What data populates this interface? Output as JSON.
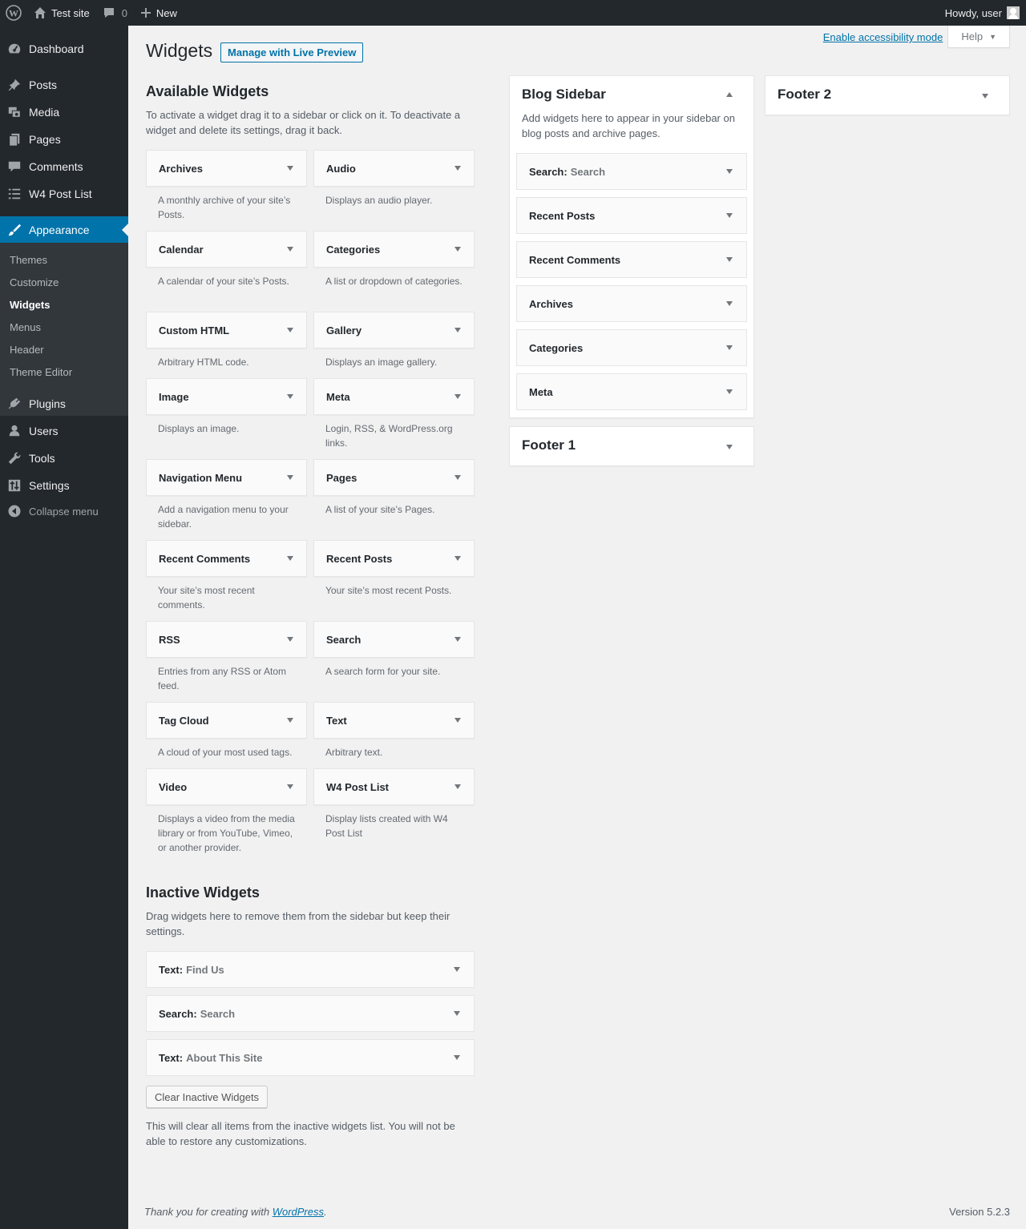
{
  "adminbar": {
    "site_name": "Test site",
    "comments_count": "0",
    "new_label": "New",
    "howdy": "Howdy, user"
  },
  "menu": {
    "items": [
      "Dashboard",
      "Posts",
      "Media",
      "Pages",
      "Comments",
      "W4 Post List",
      "Appearance",
      "Plugins",
      "Users",
      "Tools",
      "Settings"
    ],
    "submenu": [
      "Themes",
      "Customize",
      "Widgets",
      "Menus",
      "Header",
      "Theme Editor"
    ],
    "collapse": "Collapse menu"
  },
  "screen_meta": {
    "accessibility": "Enable accessibility mode",
    "help": "Help"
  },
  "header": {
    "title": "Widgets",
    "live_preview": "Manage with Live Preview"
  },
  "available": {
    "heading": "Available Widgets",
    "description": "To activate a widget drag it to a sidebar or click on it. To deactivate a widget and delete its settings, drag it back.",
    "widgets": [
      {
        "name": "Archives",
        "desc": "A monthly archive of your site’s Posts."
      },
      {
        "name": "Audio",
        "desc": "Displays an audio player."
      },
      {
        "name": "Calendar",
        "desc": "A calendar of your site’s Posts."
      },
      {
        "name": "Categories",
        "desc": "A list or dropdown of categories."
      },
      {
        "name": "Custom HTML",
        "desc": "Arbitrary HTML code."
      },
      {
        "name": "Gallery",
        "desc": "Displays an image gallery."
      },
      {
        "name": "Image",
        "desc": "Displays an image."
      },
      {
        "name": "Meta",
        "desc": "Login, RSS, & WordPress.org links."
      },
      {
        "name": "Navigation Menu",
        "desc": "Add a navigation menu to your sidebar."
      },
      {
        "name": "Pages",
        "desc": "A list of your site’s Pages."
      },
      {
        "name": "Recent Comments",
        "desc": "Your site’s most recent comments."
      },
      {
        "name": "Recent Posts",
        "desc": "Your site’s most recent Posts."
      },
      {
        "name": "RSS",
        "desc": "Entries from any RSS or Atom feed."
      },
      {
        "name": "Search",
        "desc": "A search form for your site."
      },
      {
        "name": "Tag Cloud",
        "desc": "A cloud of your most used tags."
      },
      {
        "name": "Text",
        "desc": "Arbitrary text."
      },
      {
        "name": "Video",
        "desc": "Displays a video from the media library or from YouTube, Vimeo, or another provider."
      },
      {
        "name": "W4 Post List",
        "desc": "Display lists created with W4 Post List"
      }
    ]
  },
  "blog_sidebar": {
    "title": "Blog Sidebar",
    "description": "Add widgets here to appear in your sidebar on blog posts and archive pages.",
    "widgets": [
      {
        "name": "Search:",
        "instance": "Search"
      },
      {
        "name": "Recent Posts",
        "instance": ""
      },
      {
        "name": "Recent Comments",
        "instance": ""
      },
      {
        "name": "Archives",
        "instance": ""
      },
      {
        "name": "Categories",
        "instance": ""
      },
      {
        "name": "Meta",
        "instance": ""
      }
    ]
  },
  "footer1": {
    "title": "Footer 1"
  },
  "footer2": {
    "title": "Footer 2"
  },
  "inactive": {
    "heading": "Inactive Widgets",
    "description": "Drag widgets here to remove them from the sidebar but keep their settings.",
    "widgets": [
      {
        "name": "Text:",
        "instance": "Find Us"
      },
      {
        "name": "Search:",
        "instance": "Search"
      },
      {
        "name": "Text:",
        "instance": "About This Site"
      }
    ],
    "clear_button": "Clear Inactive Widgets",
    "clear_note": "This will clear all items from the inactive widgets list. You will not be able to restore any customizations."
  },
  "footer": {
    "thanks_prefix": "Thank you for creating with ",
    "thanks_link": "WordPress",
    "thanks_suffix": ".",
    "version": "Version 5.2.3"
  }
}
